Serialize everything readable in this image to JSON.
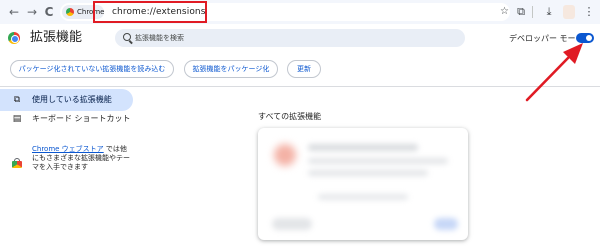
{
  "browser": {
    "back_glyph": "←",
    "forward_glyph": "→",
    "reload_glyph": "C",
    "chip_label": "Chrome",
    "url": "chrome://extensions",
    "bookmark_glyph": "☆",
    "extensions_glyph": "⧉",
    "download_glyph": "⤓",
    "menu_glyph": "⋮",
    "icons": [
      "back-icon",
      "forward-icon",
      "reload-icon",
      "bookmark-star-icon",
      "extensions-puzzle-icon",
      "download-icon",
      "kebab-menu-icon"
    ]
  },
  "header": {
    "title": "拡張機能",
    "search_placeholder": "拡張機能を検索",
    "dev_mode_label": "デベロッパー モード",
    "dev_mode_on": true
  },
  "actions": {
    "load_unpacked": "パッケージ化されていない拡張機能を読み込む",
    "pack_extension": "拡張機能をパッケージ化",
    "update": "更新"
  },
  "sidebar": {
    "items": [
      {
        "label": "使用している拡張機能",
        "icon": "puzzle-icon",
        "glyph": "⧉",
        "active": true
      },
      {
        "label": "キーボード ショートカット",
        "icon": "keyboard-icon",
        "glyph": "▤",
        "active": false
      }
    ],
    "promo": {
      "link_text": "Chrome ウェブストア",
      "text": " では他にもさまざまな拡張機能やテーマを入手できます"
    }
  },
  "main": {
    "section_title": "すべての拡張機能"
  },
  "colors": {
    "accent": "#0b57d0",
    "highlight_box": "#e01b24",
    "arrow": "#e01b24",
    "sidebar_active": "#d3e3fd"
  }
}
